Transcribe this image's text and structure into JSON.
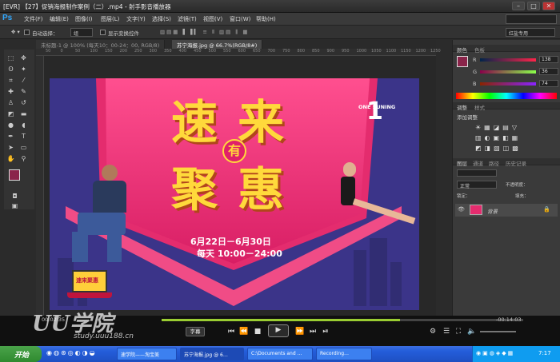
{
  "window": {
    "title": "[EVR] 【27】促销海报制作案例（二）.mp4 - 射手影音播放器"
  },
  "menubar": {
    "logo": "Ps",
    "items": [
      "文件(F)",
      "编辑(E)",
      "图像(I)",
      "图层(L)",
      "文字(Y)",
      "选择(S)",
      "滤镜(T)",
      "视图(V)",
      "窗口(W)",
      "帮助(H)"
    ]
  },
  "options": {
    "auto_select": "自动选择：",
    "auto_select_value": "组",
    "show_transform": "显示变换控件",
    "workspace": "红盐专用"
  },
  "tabs": [
    {
      "label": "未标题-1 @ 100% (每天10：00-24：00, RGB/8)"
    },
    {
      "label": "苏宁海报.jpg @ 66.7%(RGB/8#)"
    }
  ],
  "ruler": {
    "marks": [
      "50",
      "0",
      "50",
      "100",
      "150",
      "200",
      "250",
      "300",
      "350",
      "400",
      "450",
      "500",
      "550",
      "600",
      "650",
      "700",
      "750",
      "800",
      "850",
      "900",
      "950",
      "1000",
      "1050",
      "1100",
      "1150",
      "1200",
      "1250"
    ]
  },
  "poster": {
    "char1": "速",
    "char2": "来",
    "char3": "聚",
    "char4": "惠",
    "badge": "有",
    "date": "6月22日－6月30日",
    "time": "每天 10:00－24:00",
    "brand_num": "1",
    "brand": "ONE SUNING",
    "laptop_text": "速来聚惠"
  },
  "panels": {
    "color_tabs": [
      "颜色",
      "色板"
    ],
    "rgb": [
      {
        "label": "R",
        "value": "138"
      },
      {
        "label": "G",
        "value": "36"
      },
      {
        "label": "B",
        "value": "74"
      }
    ],
    "fg_color": "#8a244a",
    "adjust_tabs": [
      "调整",
      "样式"
    ],
    "adjust_title": "添加调整",
    "layer_tabs": [
      "图层",
      "通道",
      "路径",
      "历史记录"
    ],
    "blend": "正常",
    "opacity_label": "不透明度：",
    "lock_label": "锁定：",
    "fill_label": "填充：",
    "layer_name": "背景"
  },
  "player": {
    "time_current": "00:02:35",
    "time_total": "-00:14:03",
    "progress": 0.66,
    "subtitle_btn": "字幕"
  },
  "watermark": {
    "name": "UU学院",
    "url": "study.uuu188.cn"
  },
  "taskbar": {
    "start": "开始",
    "tasks": [
      "速学院——淘宝美",
      "苏宁海报.jpg @ 6…",
      "C:\\Documents and …",
      "Recording…"
    ],
    "clock": "7:17"
  }
}
